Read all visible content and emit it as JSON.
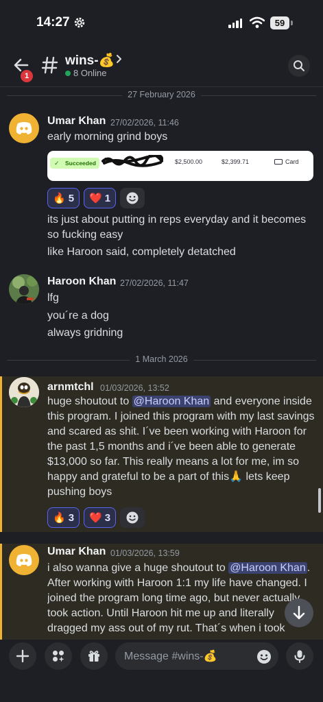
{
  "status_bar": {
    "time": "14:27",
    "battery": "59"
  },
  "header": {
    "badge_count": "1",
    "channel_name": "wins-💰",
    "online": "8 Online"
  },
  "dividers": [
    "27 February 2026",
    "1 March 2026"
  ],
  "messages": [
    {
      "author": "Umar Khan",
      "timestamp": "27/02/2026, 11:46",
      "lines": [
        "early morning grind boys"
      ],
      "embed": {
        "status": "Succeeded",
        "amount": "$2,500.00",
        "net": "$2,399.71",
        "method": "Card"
      },
      "reactions": [
        {
          "emoji": "🔥",
          "count": "5"
        },
        {
          "emoji": "❤️",
          "count": "1"
        }
      ],
      "followups": [
        "its just about putting in reps everyday and it becomes so fucking easy",
        "like Haroon said, completely detatched"
      ]
    },
    {
      "author": "Haroon Khan",
      "timestamp": "27/02/2026, 11:47",
      "lines": [
        "lfg",
        "you´re a dog",
        "always gridning"
      ]
    },
    {
      "author": "arnmtchl",
      "timestamp": "01/03/2026, 13:52",
      "text_before": "huge shoutout to ",
      "mention": "@Haroon Khan",
      "text_after": " and everyone inside this program. I joined this program with my last savings and scared as shit. I´ve been working with Haroon for the past 1,5 months and i´ve been able to generate $13,000 so far. This really means a lot for me, im so happy and grateful to be a part of this🙏 lets keep pushing boys",
      "reactions": [
        {
          "emoji": "🔥",
          "count": "3"
        },
        {
          "emoji": "❤️",
          "count": "3"
        }
      ]
    },
    {
      "author": "Umar Khan",
      "timestamp": "01/03/2026, 13:59",
      "text_before": "i also wanna give a huge shoutout to ",
      "mention": "@Haroon Khan",
      "text_after": ". After working with Haroon 1:1 my life have changed. I joined the program long time ago, but never actually took action. Until Haroon hit me up and literally dragged my ass out of my rut. That´s when i took"
    }
  ],
  "composer": {
    "placeholder": "Message #wins-💰"
  }
}
